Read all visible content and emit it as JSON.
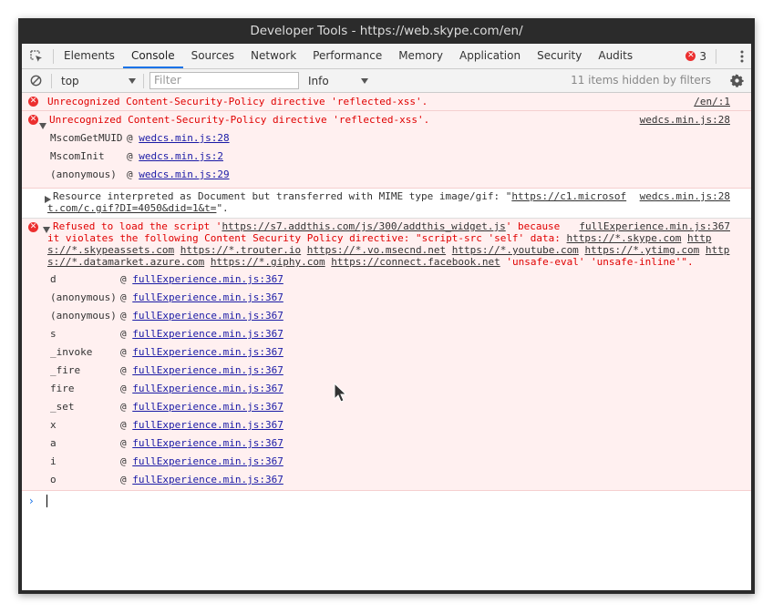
{
  "window": {
    "title": "Developer Tools - https://web.skype.com/en/"
  },
  "tabs": [
    "Elements",
    "Console",
    "Sources",
    "Network",
    "Performance",
    "Memory",
    "Application",
    "Security",
    "Audits"
  ],
  "active_tab": "Console",
  "error_count": "3",
  "toolbar": {
    "context": "top",
    "filter_placeholder": "Filter",
    "level": "Info",
    "hidden_text": "11 items hidden by filters"
  },
  "messages": {
    "m1": {
      "text": "Unrecognized Content-Security-Policy directive 'reflected-xss'.",
      "source": "/en/:1"
    },
    "m2": {
      "text": "Unrecognized Content-Security-Policy directive 'reflected-xss'.",
      "source": "wedcs.min.js:28",
      "stack": [
        {
          "fn": "MscomGetMUID",
          "loc": "wedcs.min.js:28"
        },
        {
          "fn": "MscomInit",
          "loc": "wedcs.min.js:2"
        },
        {
          "fn": "(anonymous)",
          "loc": "wedcs.min.js:29"
        }
      ]
    },
    "m3": {
      "line1_pre": "Resource interpreted as Document but transferred with MIME type image/gif: \"",
      "line1_link": "https://c1.microsof",
      "line2_link": "t.com/c.gif?DI=4050&did=1&t=",
      "line2_post": "\".",
      "source": "wedcs.min.js:28"
    },
    "m4": {
      "l1_pre": "Refused to load the script '",
      "l1_link": "https://s7.addthis.com/js/300/addthis_widget.js",
      "l1_post": "' because",
      "l2_pre": "it violates the following Content Security Policy directive: \"script-src 'self' data: ",
      "l2_link1": "https://*.skype.com",
      "l2_link2": "http",
      "l3_link1": "s://*.skypeassets.com",
      "l3_link2": "https://*.trouter.io",
      "l3_link3": "https://*.vo.msecnd.net",
      "l3_link4": "https://*.youtube.com",
      "l3_link5": "https://*.ytimg.com",
      "l3_link6": "http",
      "l4_link1": "s://*.datamarket.azure.com",
      "l4_link2": "https://*.giphy.com",
      "l4_link3": "https://connect.facebook.net",
      "l4_post": "'unsafe-eval' 'unsafe-inline'\".",
      "source": "fullExperience.min.js:367",
      "stack": [
        {
          "fn": "d",
          "loc": "fullExperience.min.js:367"
        },
        {
          "fn": "(anonymous)",
          "loc": "fullExperience.min.js:367"
        },
        {
          "fn": "(anonymous)",
          "loc": "fullExperience.min.js:367"
        },
        {
          "fn": "s",
          "loc": "fullExperience.min.js:367"
        },
        {
          "fn": "_invoke",
          "loc": "fullExperience.min.js:367"
        },
        {
          "fn": "_fire",
          "loc": "fullExperience.min.js:367"
        },
        {
          "fn": "fire",
          "loc": "fullExperience.min.js:367"
        },
        {
          "fn": "_set",
          "loc": "fullExperience.min.js:367"
        },
        {
          "fn": "x",
          "loc": "fullExperience.min.js:367"
        },
        {
          "fn": "a",
          "loc": "fullExperience.min.js:367"
        },
        {
          "fn": "i",
          "loc": "fullExperience.min.js:367"
        },
        {
          "fn": "o",
          "loc": "fullExperience.min.js:367"
        }
      ]
    }
  },
  "stack_at": "@"
}
